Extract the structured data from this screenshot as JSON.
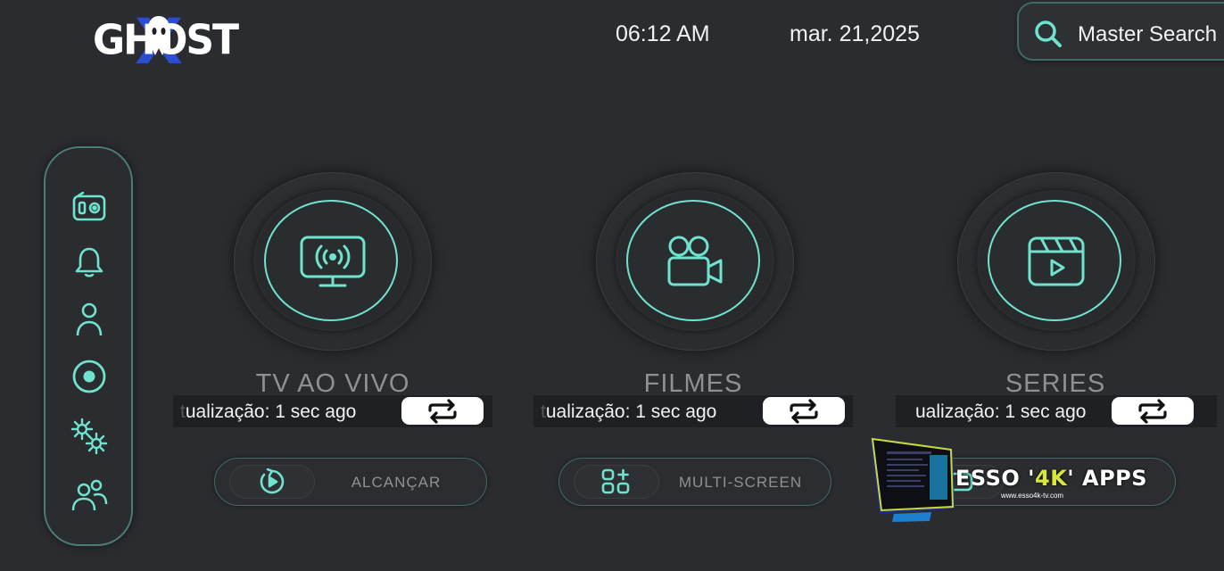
{
  "logo": {
    "text": "GHOST",
    "accent_letter": "X"
  },
  "header": {
    "time": "06:12 AM",
    "date": "mar. 21,2025",
    "search_label": "Master Search"
  },
  "sidebar": {
    "items": [
      {
        "icon": "radio-icon"
      },
      {
        "icon": "bell-icon"
      },
      {
        "icon": "user-icon"
      },
      {
        "icon": "record-icon"
      },
      {
        "icon": "settings-icon"
      },
      {
        "icon": "users-icon"
      }
    ]
  },
  "tiles": [
    {
      "title": "TV AO VIVO",
      "icon": "live-tv-icon",
      "update_prefix": "t",
      "update_text": "ualização: 1 sec ago"
    },
    {
      "title": "FILMES",
      "icon": "movie-camera-icon",
      "update_prefix": "t",
      "update_text": "ualização: 1 sec ago"
    },
    {
      "title": "SERIES",
      "icon": "clapperboard-icon",
      "update_prefix": "",
      "update_text": "ualização: 1 sec ago"
    }
  ],
  "pills": [
    {
      "label": "ALCANÇAR",
      "icon": "catchup-icon"
    },
    {
      "label": "MULTI-SCREEN",
      "icon": "multiscreen-icon"
    },
    {
      "label": "",
      "icon": "app-icon"
    }
  ],
  "watermark": {
    "title_a": "ESSO '",
    "title_b": "4K",
    "title_c": "' APPS",
    "url": "www.esso4k-tv.com"
  },
  "colors": {
    "accent": "#6fe3cd",
    "background": "#2b2c30",
    "muted": "#8e9194"
  }
}
